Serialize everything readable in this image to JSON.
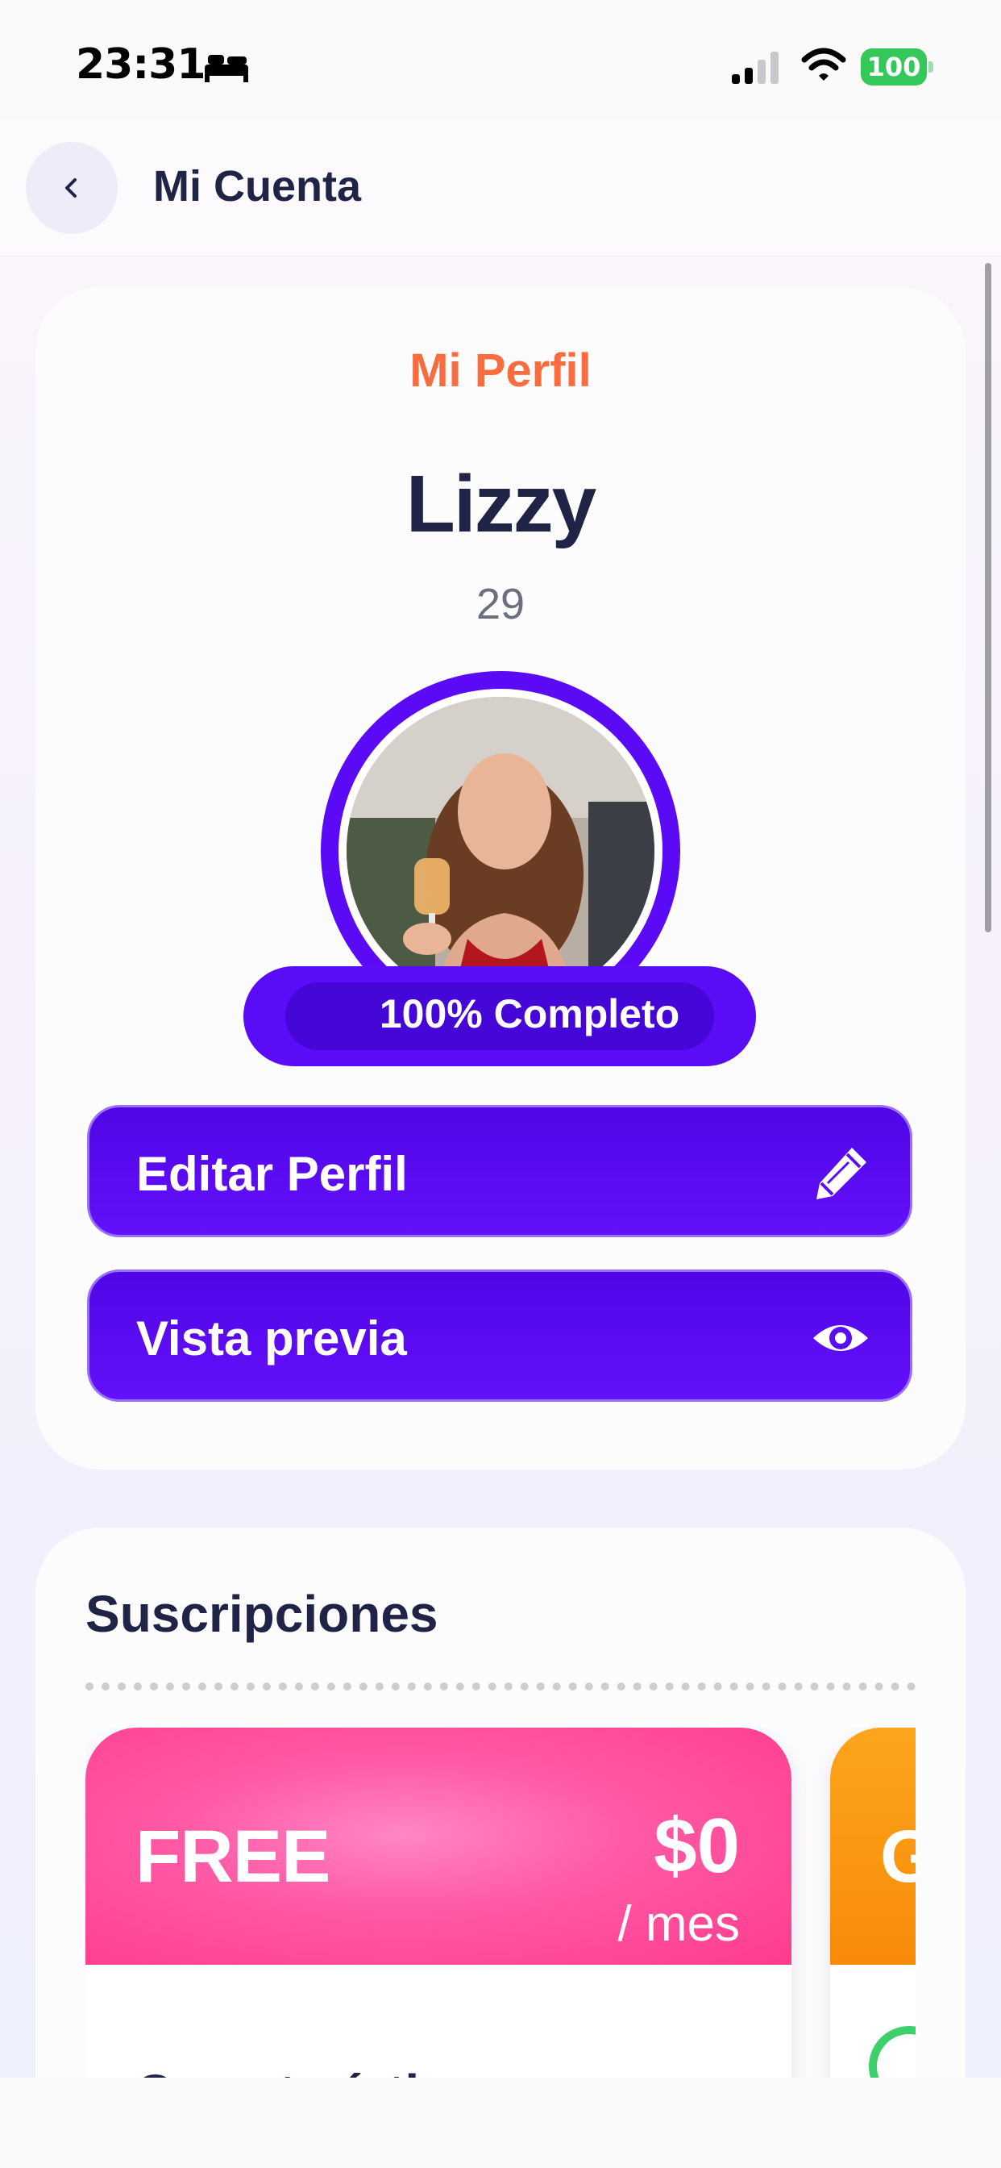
{
  "status_bar": {
    "time": "23:31",
    "battery": "100",
    "icons": [
      "bed-icon",
      "signal-icon",
      "wifi-icon",
      "battery-icon"
    ]
  },
  "header": {
    "title": "Mi Cuenta",
    "back_icon": "chevron-left-icon"
  },
  "profile": {
    "heading": "Mi Perfil",
    "name": "Lizzy",
    "age": "29",
    "completion_label": "100% Completo",
    "completion_fraction": 1.0,
    "edit_label": "Editar Perfil",
    "edit_icon": "pencil-icon",
    "preview_label": "Vista previa",
    "preview_icon": "eye-icon"
  },
  "subscriptions": {
    "title": "Suscripciones",
    "plans": [
      {
        "name": "FREE",
        "price": "$0",
        "period": "/ mes",
        "features_label": "Características",
        "color": "#ff4f9e"
      },
      {
        "name": "G",
        "color": "#f99412"
      }
    ]
  },
  "colors": {
    "accent": "#5a0cf6",
    "heading_orange": "#f76d3f",
    "text_dark": "#1f2346",
    "battery_green": "#34c759"
  }
}
